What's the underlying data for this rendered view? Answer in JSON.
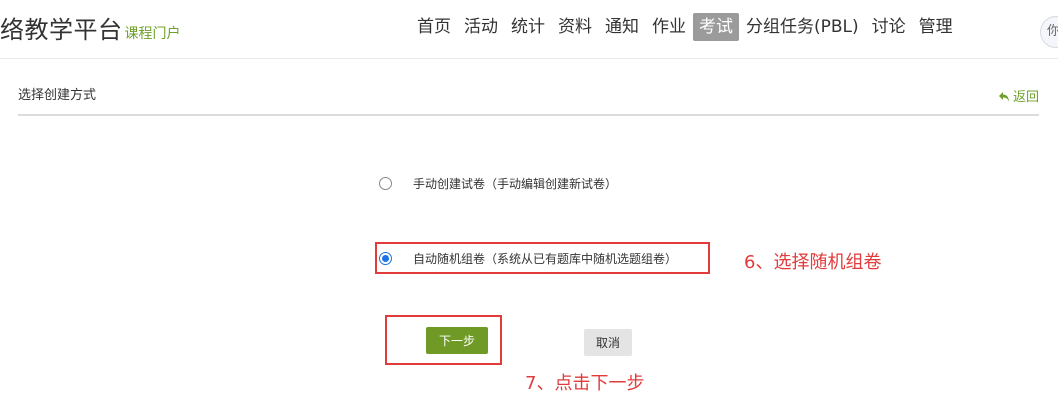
{
  "header": {
    "brand_title": "络教学平台",
    "brand_subtitle": "课程门户",
    "nav": [
      "首页",
      "活动",
      "统计",
      "资料",
      "通知",
      "作业",
      "考试",
      "分组任务(PBL)",
      "讨论",
      "管理"
    ],
    "active_nav": "考试",
    "avatar_text": "你"
  },
  "subheader": {
    "title": "选择创建方式",
    "back_label": "返回"
  },
  "options": [
    {
      "label": "手动创建试卷（手动编辑创建新试卷）",
      "checked": false
    },
    {
      "label": "自动随机组卷（系统从已有题库中随机选题组卷）",
      "checked": true
    }
  ],
  "buttons": {
    "next": "下一步",
    "cancel": "取消"
  },
  "annotations": {
    "step6": "6、选择随机组卷",
    "step7": "7、点击下一步",
    "color": "#e23b3b"
  },
  "colors": {
    "accent_green": "#6e9a25",
    "radio_blue": "#1a73e8"
  }
}
